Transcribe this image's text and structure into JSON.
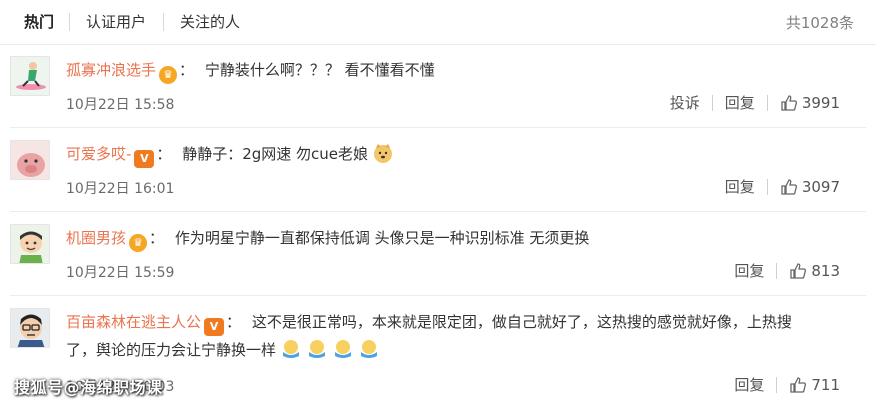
{
  "tabs": [
    {
      "label": "热门",
      "active": true
    },
    {
      "label": "认证用户",
      "active": false
    },
    {
      "label": "关注的人",
      "active": false
    }
  ],
  "total": "共1028条",
  "comments": [
    {
      "user": "孤寡冲浪选手",
      "badge": "crown",
      "text": "宁静装什么啊？？？ 看不懂看不懂",
      "text2": "",
      "emojis": 0,
      "time": "10月22日 15:58",
      "report": "投诉",
      "reply": "回复",
      "likes": "3991"
    },
    {
      "user": "可爱多哎-",
      "badge": "v",
      "text": "静静子：2g网速 勿cue老娘",
      "text2": "",
      "emojis": 1,
      "time": "10月22日 16:01",
      "report": "",
      "reply": "回复",
      "likes": "3097"
    },
    {
      "user": "机圈男孩",
      "badge": "crown",
      "text": "作为明星宁静一直都保持低调 头像只是一种识别标准 无须更换",
      "text2": "",
      "emojis": 0,
      "time": "10月22日 15:59",
      "report": "",
      "reply": "回复",
      "likes": "813"
    },
    {
      "user": "百亩森林在逃主人公",
      "badge": "v",
      "text": "这不是很正常吗，本来就是限定团，做自己就好了，这热搜的感觉就好像，上热搜",
      "text2": "了，舆论的压力会让宁静换一样",
      "emojis": 4,
      "time": "10月22日 16:03",
      "report": "",
      "reply": "回复",
      "likes": "711"
    }
  ],
  "watermark": "搜狐号@海绵职场课",
  "colors": {
    "username": "#eb7350",
    "muted": "#808080"
  }
}
